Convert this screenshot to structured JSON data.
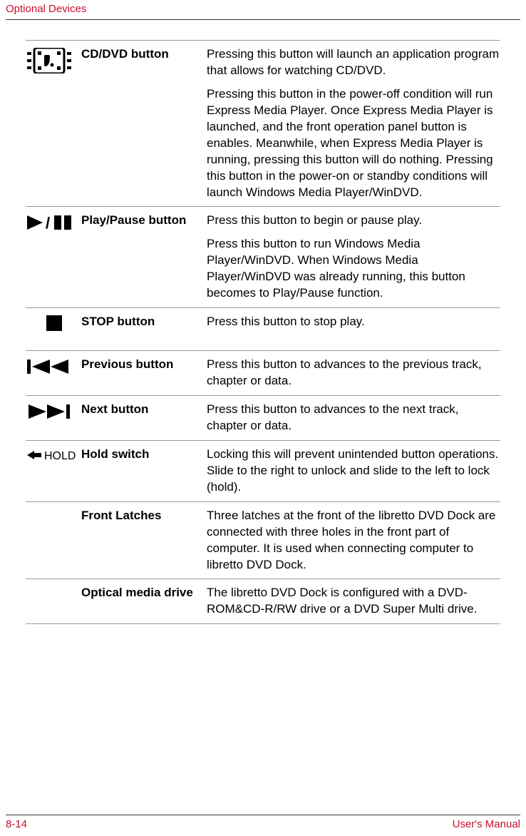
{
  "header": {
    "title": "Optional Devices"
  },
  "rows": [
    {
      "icon": "cd-dvd-icon",
      "label": "CD/DVD button",
      "desc": [
        "Pressing this button will launch an application program that allows for watching CD/DVD.",
        "Pressing this button in the power-off condition will run Express Media Player. Once Express Media Player is launched, and the front operation panel button is enables. Meanwhile, when Express Media Player is running, pressing this button will do nothing. Pressing this button in the power-on or standby conditions will launch Windows Media Player/WinDVD."
      ]
    },
    {
      "icon": "play-pause-icon",
      "label": "Play/Pause button",
      "desc": [
        "Press this button to begin or pause play.",
        "Press this button to run Windows Media Player/WinDVD. When Windows Media Player/WinDVD was already running, this button becomes to Play/Pause function."
      ]
    },
    {
      "icon": "stop-icon",
      "label": "STOP button",
      "desc": [
        "Press this button to stop play."
      ]
    },
    {
      "icon": "previous-icon",
      "label": "Previous button",
      "desc": [
        "Press this button to advances to the previous track, chapter or data."
      ]
    },
    {
      "icon": "next-icon",
      "label": "Next button",
      "desc": [
        "Press this button to advances to the next track, chapter or data."
      ]
    },
    {
      "icon": "hold-icon",
      "label": "Hold switch",
      "desc": [
        "Locking this will prevent unintended button operations. Slide to the right to unlock and slide to the left to lock (hold)."
      ]
    },
    {
      "icon": "",
      "label": "Front Latches",
      "desc": [
        "Three latches at the front of the libretto DVD Dock are connected with three holes in the front part of computer. It is used when connecting computer to libretto DVD Dock."
      ]
    },
    {
      "icon": "",
      "label": "Optical media drive",
      "desc": [
        "The libretto DVD Dock is configured with a DVD-ROM&CD-R/RW drive or a DVD Super Multi drive."
      ]
    }
  ],
  "footer": {
    "page": "8-14",
    "note": "User's Manual"
  }
}
